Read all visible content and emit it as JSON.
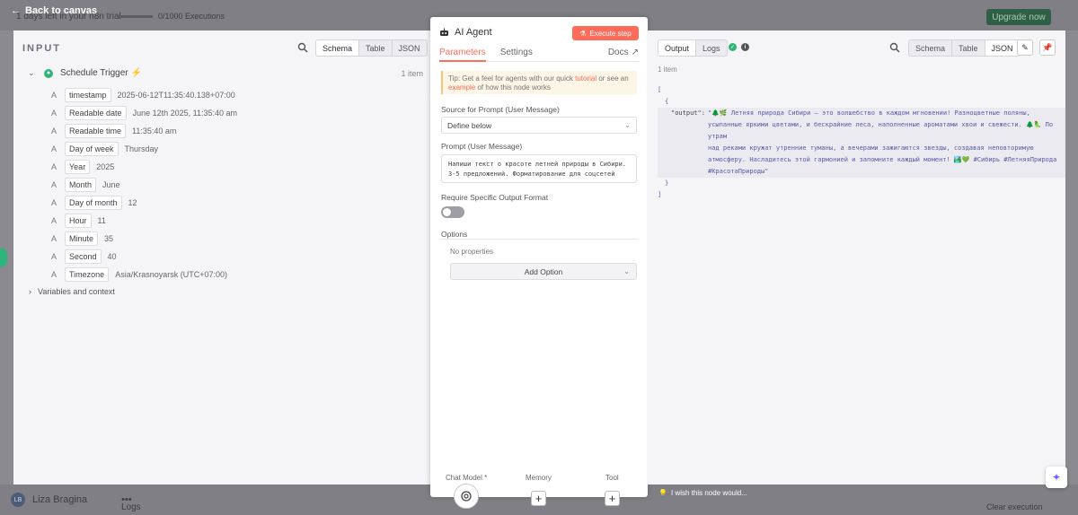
{
  "background": {
    "back_label": "Back to canvas",
    "trial_text": "1 days left in your n8n trial",
    "executions_text": "0/1000 Executions",
    "upgrade_label": "Upgrade now",
    "user_initials": "LB",
    "user_name": "Liza Bragina",
    "user_menu": "•••",
    "logs_label": "Logs",
    "clear_label": "Clear execution"
  },
  "input": {
    "title": "INPUT",
    "views": [
      "Schema",
      "Table",
      "JSON"
    ],
    "active_view": "Schema",
    "trigger_name": "Schedule Trigger",
    "item_count": "1 item",
    "fields": [
      {
        "key": "timestamp",
        "value": "2025-06-12T11:35:40.138+07:00"
      },
      {
        "key": "Readable date",
        "value": "June 12th 2025, 11:35:40 am"
      },
      {
        "key": "Readable time",
        "value": "11:35:40 am"
      },
      {
        "key": "Day of week",
        "value": "Thursday"
      },
      {
        "key": "Year",
        "value": "2025"
      },
      {
        "key": "Month",
        "value": "June"
      },
      {
        "key": "Day of month",
        "value": "12"
      },
      {
        "key": "Hour",
        "value": "11"
      },
      {
        "key": "Minute",
        "value": "35"
      },
      {
        "key": "Second",
        "value": "40"
      },
      {
        "key": "Timezone",
        "value": "Asia/Krasnoyarsk (UTC+07:00)"
      }
    ],
    "field_type_icon": "A",
    "variables_label": "Variables and context"
  },
  "agent": {
    "title": "AI Agent",
    "execute_label": "Execute step",
    "tabs": [
      "Parameters",
      "Settings"
    ],
    "docs_label": "Docs",
    "tip_prefix": "Tip: Get a feel for agents with our quick ",
    "tip_link1": "tutorial",
    "tip_middle": " or see an ",
    "tip_link2": "example",
    "tip_suffix": " of how this node works",
    "source_label": "Source for Prompt (User Message)",
    "source_value": "Define below",
    "prompt_label": "Prompt (User Message)",
    "prompt_value": "Напиши текст о красоте летней природы в Сибири. 3-5 предложений. Форматирование для соцсетей",
    "require_label": "Require Specific Output Format",
    "options_label": "Options",
    "no_props": "No properties",
    "add_option": "Add Option",
    "chat_model_label": "Chat Model *",
    "memory_label": "Memory",
    "tool_label": "Tool"
  },
  "output": {
    "views": [
      "Output",
      "Logs"
    ],
    "active_view": "Output",
    "formats": [
      "Schema",
      "Table",
      "JSON"
    ],
    "active_format": "JSON",
    "item_count": "1 item",
    "json_open": "[",
    "json_obj_open": "{",
    "json_key": "\"output\":",
    "json_lines": [
      "\"🌲🌿 Летняя природа Сибири — это волшебство в каждом мгновении! Разноцветные поляны,",
      "усыпанные яркими цветами, и бескрайние леса, наполненные ароматами хвои и свежести. 🌲🦜 По утрам",
      "над реками кружат утренние туманы, а вечерами зажигаются звезды, создавая неповторимую",
      "атмосферу. Насладитесь этой гармонией и запомните каждый момент! 🏞️💚 #Сибирь #ЛетняяПрирода",
      "#КрасотаПрироды\""
    ],
    "json_obj_close": "}",
    "json_close": "]",
    "wish_label": "I wish this node would..."
  }
}
